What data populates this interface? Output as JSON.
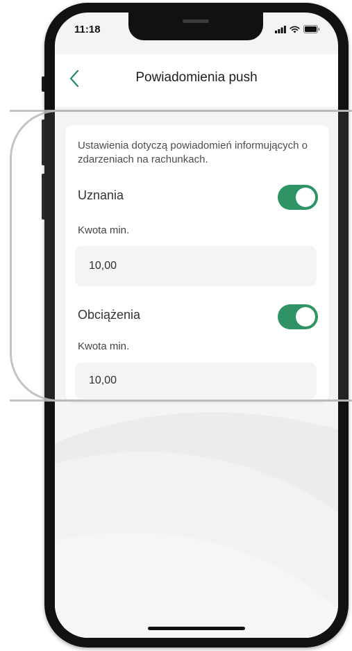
{
  "status_bar": {
    "time": "11:18"
  },
  "header": {
    "title": "Powiadomienia push",
    "back_icon": "chevron-left-icon"
  },
  "card": {
    "description": "Ustawienia dotyczą powiadomień informujących o zdarzeniach na rachunkach.",
    "credits": {
      "label": "Uznania",
      "toggle_on": true,
      "amount_label": "Kwota min.",
      "amount_value": "10,00"
    },
    "debits": {
      "label": "Obciążenia",
      "toggle_on": true,
      "amount_label": "Kwota min.",
      "amount_value": "10,00"
    }
  },
  "colors": {
    "accent": "#1f8a5a",
    "back_icon": "#1f8a5a",
    "screen_background": "#f4f4f4"
  }
}
